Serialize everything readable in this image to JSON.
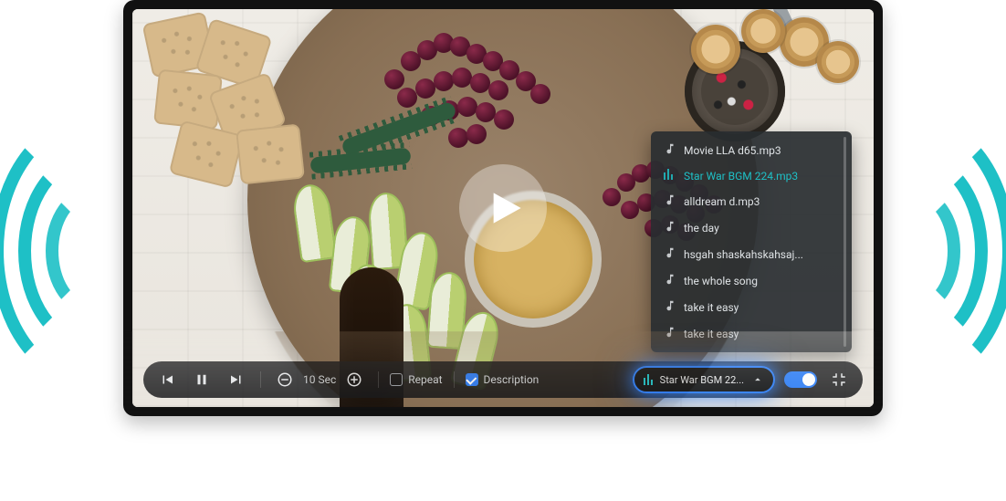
{
  "colors": {
    "accent": "#1ec0c6"
  },
  "play_button": {
    "name": "play"
  },
  "controls": {
    "prev": "previous",
    "pause": "pause",
    "next": "next",
    "seek_label": "10 Sec",
    "repeat_label": "Repeat",
    "repeat_checked": false,
    "description_label": "Description",
    "description_checked": true,
    "fullscreen_exit": "exit-fullscreen"
  },
  "current_track": {
    "name_short": "Star War BGM 22...",
    "icon": "equalizer-icon",
    "dropdown": "chevron-up-icon",
    "toggle_on": true
  },
  "playlist": {
    "active_index": 1,
    "items": [
      {
        "icon": "music-note-icon",
        "label": "Movie LLA d65.mp3"
      },
      {
        "icon": "equalizer-icon",
        "label": "Star War BGM 224.mp3"
      },
      {
        "icon": "music-note-icon",
        "label": "alldream d.mp3"
      },
      {
        "icon": "music-note-icon",
        "label": "the day"
      },
      {
        "icon": "music-note-icon",
        "label": "hsgah shaskahskahsaj..."
      },
      {
        "icon": "music-note-icon",
        "label": "the whole song"
      },
      {
        "icon": "music-note-icon",
        "label": "take it easy"
      },
      {
        "icon": "music-note-icon",
        "label": "take it easy"
      }
    ]
  }
}
